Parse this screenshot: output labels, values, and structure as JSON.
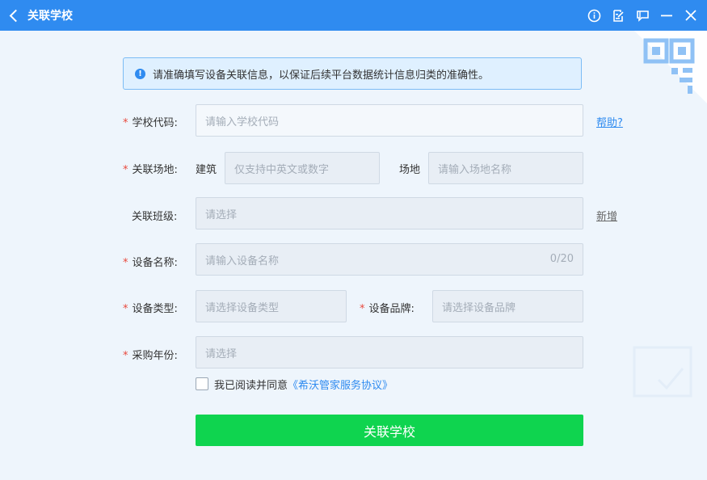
{
  "titlebar": {
    "title": "关联学校",
    "icons": [
      "info-icon",
      "edit-icon",
      "comment-icon",
      "minimize-icon",
      "close-icon"
    ]
  },
  "notice": {
    "text": "请准确填写设备关联信息，以保证后续平台数据统计信息归类的准确性。"
  },
  "form": {
    "school_code": {
      "label": "学校代码:",
      "placeholder": "请输入学校代码",
      "help": "帮助?"
    },
    "venue": {
      "label": "关联场地:",
      "building_label": "建筑",
      "building_placeholder": "仅支持中英文或数字",
      "site_label": "场地",
      "site_placeholder": "请输入场地名称"
    },
    "class": {
      "label": "关联班级:",
      "placeholder": "请选择",
      "add": "新增"
    },
    "device_name": {
      "label": "设备名称:",
      "placeholder": "请输入设备名称",
      "counter": "0/20"
    },
    "device_type": {
      "label": "设备类型:",
      "placeholder": "请选择设备类型"
    },
    "device_brand": {
      "label": "设备品牌:",
      "placeholder": "请选择设备品牌"
    },
    "purchase_year": {
      "label": "采购年份:",
      "placeholder": "请选择"
    },
    "required_mark": "*"
  },
  "agreement": {
    "prefix": "我已阅读并同意",
    "link": "《希沃管家服务协议》",
    "checked": false
  },
  "submit_label": "关联学校",
  "colors": {
    "titlebar": "#2f8bf0",
    "submit": "#0fd44f",
    "required": "#e8493d",
    "link": "#2f8bf0"
  }
}
